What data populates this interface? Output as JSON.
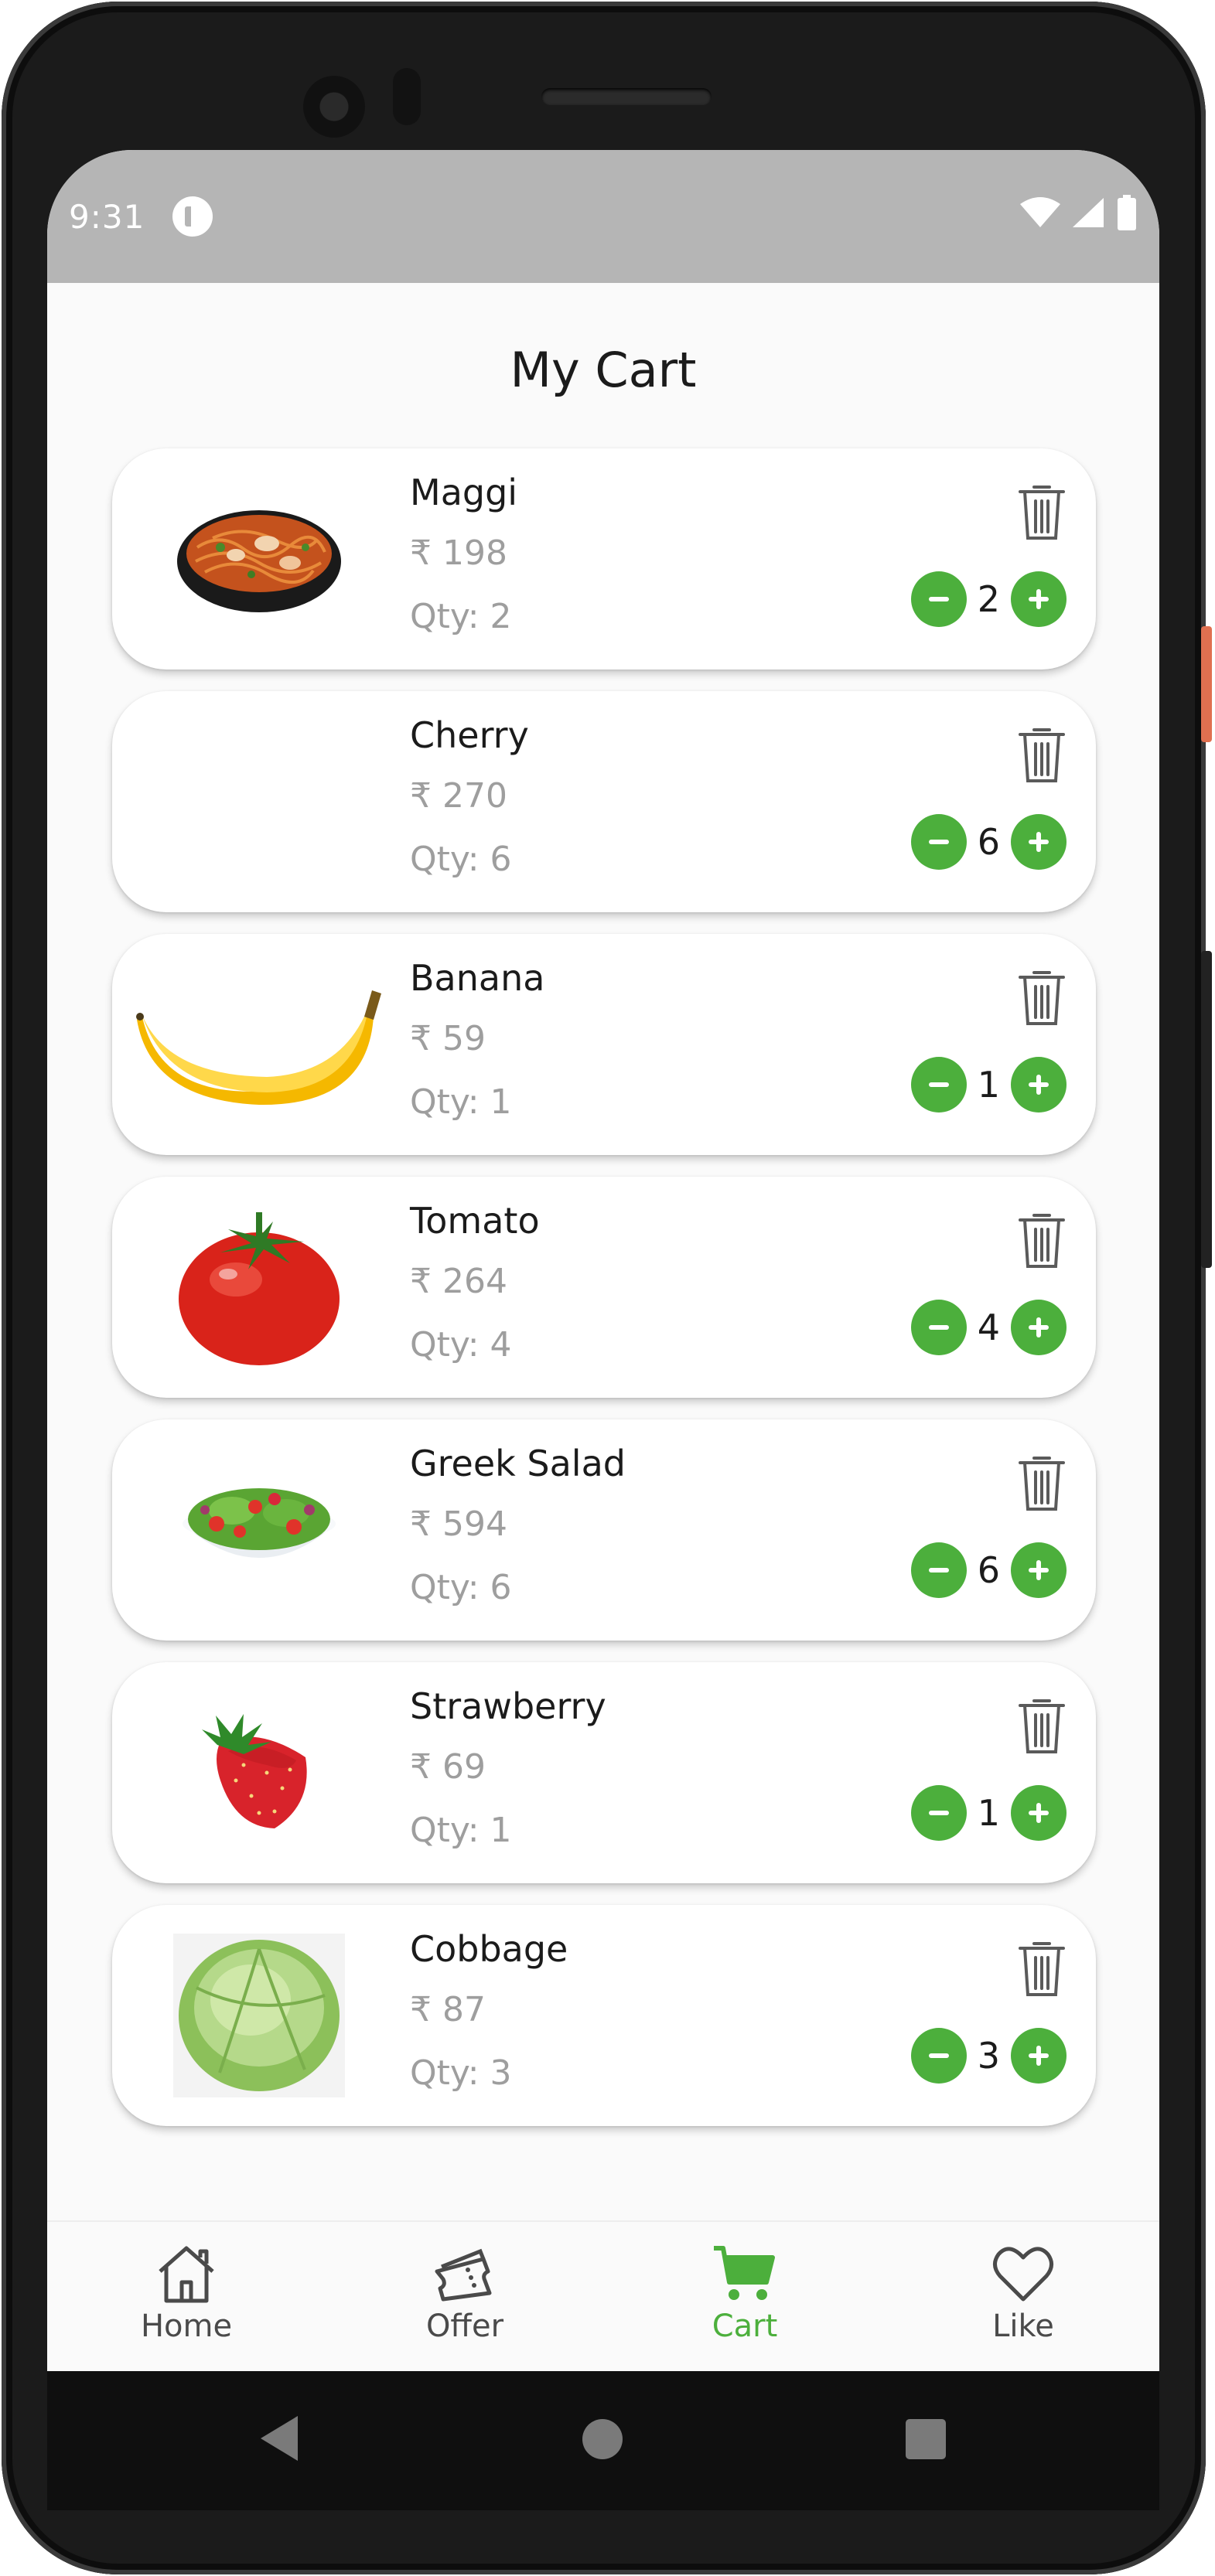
{
  "status_bar": {
    "time": "9:31"
  },
  "header": {
    "title": "My Cart"
  },
  "cart": {
    "items": [
      {
        "name": "Maggi",
        "price": "₹ 198",
        "qty_text": "Qty: 2",
        "count": "2",
        "image": "noodles-bowl"
      },
      {
        "name": "Cherry",
        "price": "₹ 270",
        "qty_text": "Qty: 6",
        "count": "6",
        "image": "none"
      },
      {
        "name": "Banana",
        "price": "₹ 59",
        "qty_text": "Qty: 1",
        "count": "1",
        "image": "banana"
      },
      {
        "name": "Tomato",
        "price": "₹ 264",
        "qty_text": "Qty: 4",
        "count": "4",
        "image": "tomato"
      },
      {
        "name": "Greek Salad",
        "price": "₹ 594",
        "qty_text": "Qty: 6",
        "count": "6",
        "image": "salad-bowl"
      },
      {
        "name": "Strawberry",
        "price": "₹ 69",
        "qty_text": "Qty: 1",
        "count": "1",
        "image": "strawberry"
      },
      {
        "name": "Cobbage",
        "price": "₹ 87",
        "qty_text": "Qty: 3",
        "count": "3",
        "image": "cabbage"
      }
    ]
  },
  "bottom_nav": {
    "items": [
      {
        "label": "Home",
        "icon": "home-icon",
        "active": false
      },
      {
        "label": "Offer",
        "icon": "ticket-icon",
        "active": false
      },
      {
        "label": "Cart",
        "icon": "cart-icon",
        "active": true
      },
      {
        "label": "Like",
        "icon": "heart-icon",
        "active": false
      }
    ]
  },
  "colors": {
    "accent": "#4caf3c",
    "status_bar": "#b5b5b5",
    "muted_text": "#9e9e9e",
    "background": "#fafafa"
  }
}
